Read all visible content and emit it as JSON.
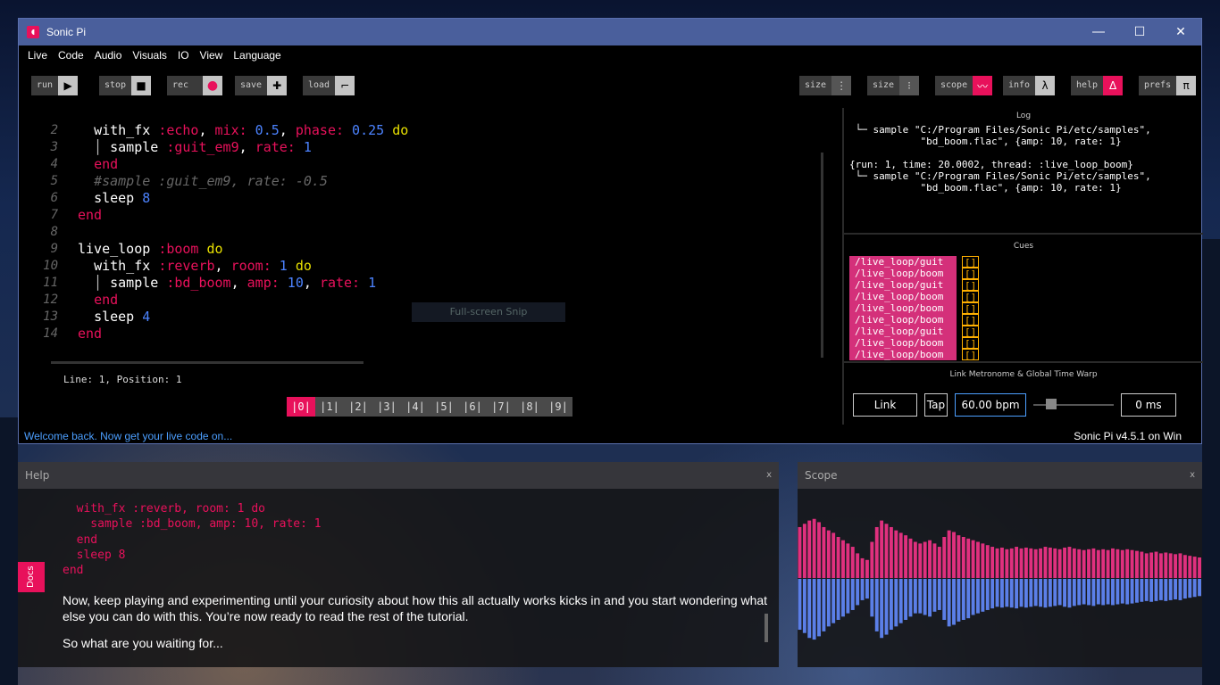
{
  "window": {
    "title": "Sonic Pi"
  },
  "menu": [
    "Live",
    "Code",
    "Audio",
    "Visuals",
    "IO",
    "View",
    "Language"
  ],
  "toolbar": {
    "run": "run",
    "stop": "stop",
    "rec": "rec",
    "save": "save",
    "load": "load",
    "size1": "size",
    "size2": "size",
    "scope": "scope",
    "info": "info",
    "help": "help",
    "prefs": "prefs"
  },
  "editor": {
    "lines": [
      {
        "n": "2",
        "indent": "  ",
        "tokens": [
          [
            "kw",
            "with_fx "
          ],
          [
            "sym",
            ":echo"
          ],
          [
            "kw",
            ", "
          ],
          [
            "sym",
            "mix:"
          ],
          [
            "num",
            " 0.5"
          ],
          [
            "kw",
            ", "
          ],
          [
            "sym",
            "phase:"
          ],
          [
            "num",
            " 0.25"
          ],
          [
            "dokw",
            " do"
          ]
        ]
      },
      {
        "n": "3",
        "indent": "  │ ",
        "tokens": [
          [
            "kw",
            "sample "
          ],
          [
            "sym",
            ":guit_em9"
          ],
          [
            "kw",
            ", "
          ],
          [
            "sym",
            "rate:"
          ],
          [
            "num",
            " 1"
          ]
        ]
      },
      {
        "n": "4",
        "indent": "  ",
        "tokens": [
          [
            "sym",
            "end"
          ]
        ]
      },
      {
        "n": "5",
        "indent": "  ",
        "tokens": [
          [
            "cmt",
            "#sample :guit_em9, rate: -0.5"
          ]
        ]
      },
      {
        "n": "6",
        "indent": "  ",
        "tokens": [
          [
            "kw",
            "sleep "
          ],
          [
            "num",
            "8"
          ]
        ]
      },
      {
        "n": "7",
        "indent": "",
        "tokens": [
          [
            "sym",
            "end"
          ]
        ]
      },
      {
        "n": "8",
        "indent": "",
        "tokens": []
      },
      {
        "n": "9",
        "indent": "",
        "tokens": [
          [
            "kw",
            "live_loop "
          ],
          [
            "sym",
            ":boom"
          ],
          [
            "dokw",
            " do"
          ]
        ]
      },
      {
        "n": "10",
        "indent": "  ",
        "tokens": [
          [
            "kw",
            "with_fx "
          ],
          [
            "sym",
            ":reverb"
          ],
          [
            "kw",
            ", "
          ],
          [
            "sym",
            "room:"
          ],
          [
            "num",
            " 1"
          ],
          [
            "dokw",
            " do"
          ]
        ]
      },
      {
        "n": "11",
        "indent": "  │ ",
        "tokens": [
          [
            "kw",
            "sample "
          ],
          [
            "sym",
            ":bd_boom"
          ],
          [
            "kw",
            ", "
          ],
          [
            "sym",
            "amp:"
          ],
          [
            "num",
            " 10"
          ],
          [
            "kw",
            ", "
          ],
          [
            "sym",
            "rate:"
          ],
          [
            "num",
            " 1"
          ]
        ]
      },
      {
        "n": "12",
        "indent": "  ",
        "tokens": [
          [
            "sym",
            "end"
          ]
        ]
      },
      {
        "n": "13",
        "indent": "  ",
        "tokens": [
          [
            "kw",
            "sleep "
          ],
          [
            "num",
            "4"
          ]
        ]
      },
      {
        "n": "14",
        "indent": "",
        "tokens": [
          [
            "sym",
            "end"
          ]
        ]
      }
    ],
    "watermark": "Full-screen Snip",
    "status": "Line: 1,  Position: 1",
    "buffers": [
      "|0|",
      "|1|",
      "|2|",
      "|3|",
      "|4|",
      "|5|",
      "|6|",
      "|7|",
      "|8|",
      "|9|"
    ],
    "active_buffer": 0
  },
  "footer": {
    "welcome": "Welcome back. Now get your live code on...",
    "version": "Sonic Pi v4.5.1 on Win"
  },
  "log": {
    "title": "Log",
    "text": " └─ sample \"C:/Program Files/Sonic Pi/etc/samples\",\n            \"bd_boom.flac\", {amp: 10, rate: 1}\n\n{run: 1, time: 20.0002, thread: :live_loop_boom}\n └─ sample \"C:/Program Files/Sonic Pi/etc/samples\",\n            \"bd_boom.flac\", {amp: 10, rate: 1}"
  },
  "cues": {
    "title": "Cues",
    "items": [
      {
        "path": "/live_loop/guit",
        "arg": "[]"
      },
      {
        "path": "/live_loop/boom",
        "arg": "[]"
      },
      {
        "path": "/live_loop/guit",
        "arg": "[]"
      },
      {
        "path": "/live_loop/boom",
        "arg": "[]"
      },
      {
        "path": "/live_loop/boom",
        "arg": "[]"
      },
      {
        "path": "/live_loop/boom",
        "arg": "[]"
      },
      {
        "path": "/live_loop/guit",
        "arg": "[]"
      },
      {
        "path": "/live_loop/boom",
        "arg": "[]"
      },
      {
        "path": "/live_loop/boom",
        "arg": "[]"
      }
    ]
  },
  "link": {
    "title": "Link Metronome & Global Time Warp",
    "link": "Link",
    "tap": "Tap",
    "bpm": "60.00 bpm",
    "warp": "0 ms"
  },
  "help": {
    "title": "Help",
    "close": "x",
    "docs_tab": "Docs",
    "code": "  with_fx :reverb, room: 1 do\n    sample :bd_boom, amp: 10, rate: 1\n  end\n  sleep 8\nend",
    "p1": "Now, keep playing and experimenting until your curiosity about how this all actually works kicks in and you start wondering what else you can do with this. You’re now ready to read the rest of the tutorial.",
    "p2": "So what are you waiting for..."
  },
  "scope": {
    "title": "Scope",
    "close": "x",
    "top_color": "#e0307e",
    "bottom_color": "#5b7fe8",
    "top": [
      0.62,
      0.66,
      0.7,
      0.72,
      0.68,
      0.62,
      0.58,
      0.55,
      0.5,
      0.46,
      0.42,
      0.38,
      0.3,
      0.24,
      0.22,
      0.44,
      0.62,
      0.7,
      0.66,
      0.62,
      0.58,
      0.55,
      0.52,
      0.48,
      0.44,
      0.42,
      0.44,
      0.46,
      0.42,
      0.38,
      0.5,
      0.58,
      0.56,
      0.52,
      0.5,
      0.48,
      0.46,
      0.44,
      0.42,
      0.4,
      0.38,
      0.36,
      0.37,
      0.35,
      0.36,
      0.38,
      0.36,
      0.37,
      0.36,
      0.35,
      0.36,
      0.38,
      0.37,
      0.36,
      0.35,
      0.37,
      0.38,
      0.36,
      0.35,
      0.34,
      0.35,
      0.36,
      0.34,
      0.35,
      0.34,
      0.36,
      0.35,
      0.34,
      0.35,
      0.34,
      0.33,
      0.32,
      0.3,
      0.31,
      0.32,
      0.3,
      0.31,
      0.3,
      0.29,
      0.3,
      0.28,
      0.27,
      0.26,
      0.25
    ],
    "bottom": [
      0.62,
      0.66,
      0.72,
      0.74,
      0.7,
      0.64,
      0.58,
      0.54,
      0.5,
      0.46,
      0.42,
      0.38,
      0.32,
      0.26,
      0.24,
      0.46,
      0.64,
      0.72,
      0.68,
      0.62,
      0.58,
      0.54,
      0.5,
      0.46,
      0.42,
      0.42,
      0.44,
      0.46,
      0.4,
      0.38,
      0.5,
      0.58,
      0.56,
      0.52,
      0.5,
      0.48,
      0.44,
      0.42,
      0.4,
      0.38,
      0.36,
      0.34,
      0.35,
      0.34,
      0.35,
      0.36,
      0.34,
      0.35,
      0.34,
      0.33,
      0.34,
      0.35,
      0.34,
      0.33,
      0.32,
      0.34,
      0.35,
      0.33,
      0.32,
      0.31,
      0.32,
      0.33,
      0.31,
      0.32,
      0.31,
      0.32,
      0.31,
      0.3,
      0.31,
      0.3,
      0.29,
      0.28,
      0.27,
      0.28,
      0.27,
      0.26,
      0.27,
      0.26,
      0.25,
      0.26,
      0.24,
      0.23,
      0.22,
      0.21
    ]
  }
}
